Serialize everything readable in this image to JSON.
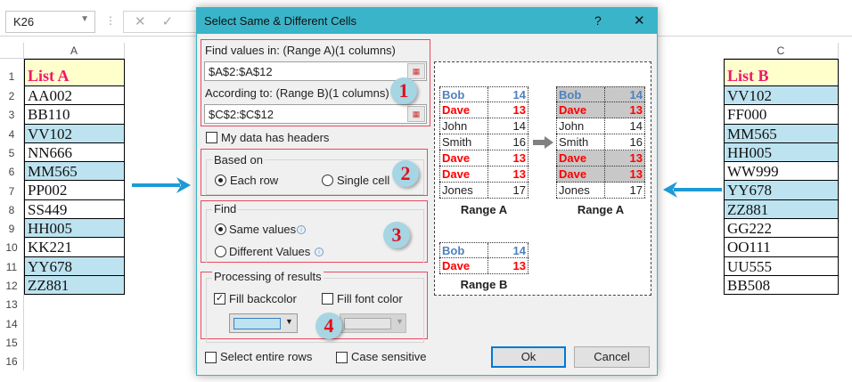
{
  "excel": {
    "name_box": "K26",
    "col_a": "A",
    "col_c": "C",
    "rows": [
      "1",
      "2",
      "3",
      "4",
      "5",
      "6",
      "7",
      "8",
      "9",
      "10",
      "11",
      "12",
      "13",
      "14",
      "15",
      "16"
    ],
    "list_a": {
      "header": "List A",
      "items": [
        {
          "v": "AA002",
          "hl": false
        },
        {
          "v": "BB110",
          "hl": false
        },
        {
          "v": "VV102",
          "hl": true
        },
        {
          "v": "NN666",
          "hl": false
        },
        {
          "v": "MM565",
          "hl": true
        },
        {
          "v": "PP002",
          "hl": false
        },
        {
          "v": "SS449",
          "hl": false
        },
        {
          "v": "HH005",
          "hl": true
        },
        {
          "v": "KK221",
          "hl": false
        },
        {
          "v": "YY678",
          "hl": true
        },
        {
          "v": "ZZ881",
          "hl": true
        }
      ]
    },
    "list_b": {
      "header": "List B",
      "items": [
        {
          "v": "VV102",
          "hl": true
        },
        {
          "v": "FF000",
          "hl": false
        },
        {
          "v": "MM565",
          "hl": true
        },
        {
          "v": "HH005",
          "hl": true
        },
        {
          "v": "WW999",
          "hl": false
        },
        {
          "v": "YY678",
          "hl": true
        },
        {
          "v": "ZZ881",
          "hl": true
        },
        {
          "v": "GG222",
          "hl": false
        },
        {
          "v": "OO111",
          "hl": false
        },
        {
          "v": "UU555",
          "hl": false
        },
        {
          "v": "BB508",
          "hl": false
        }
      ]
    },
    "highlight_color": "#bde3f0",
    "arrow_color": "#1e9ad6"
  },
  "dialog": {
    "title": "Select Same & Different Cells",
    "help": "?",
    "close": "✕",
    "find_values_label": "Find values in: (Range A)(1 columns)",
    "find_values": "$A$2:$A$12",
    "according_label": "According to: (Range B)(1 columns)",
    "according": "$C$2:$C$12",
    "headers_label": "My data has headers",
    "based_on": "Based on",
    "each_row": "Each row",
    "single_cell": "Single cell",
    "find": "Find",
    "same_values": "Same values",
    "different_values": "Different Values",
    "processing": "Processing of results",
    "fill_backcolor": "Fill backcolor",
    "fill_font_color": "Fill font color",
    "backcolor": "#bde3f0",
    "select_entire_rows": "Select entire rows",
    "case_sensitive": "Case sensitive",
    "ok": "Ok",
    "cancel": "Cancel",
    "badges": [
      "1",
      "2",
      "3",
      "4"
    ],
    "preview": {
      "range_a_label": "Range A",
      "range_b_label": "Range B",
      "range_a": [
        [
          "Bob",
          "14",
          "blue"
        ],
        [
          "Dave",
          "13",
          "red"
        ],
        [
          "John",
          "14",
          ""
        ],
        [
          "Smith",
          "16",
          ""
        ],
        [
          "Dave",
          "13",
          "red"
        ],
        [
          "Dave",
          "13",
          "red"
        ],
        [
          "Jones",
          "17",
          ""
        ]
      ],
      "range_a_result_highlight": [
        true,
        true,
        false,
        false,
        true,
        true,
        false
      ],
      "range_b": [
        [
          "Bob",
          "14",
          "blue"
        ],
        [
          "Dave",
          "13",
          "red"
        ]
      ]
    }
  }
}
